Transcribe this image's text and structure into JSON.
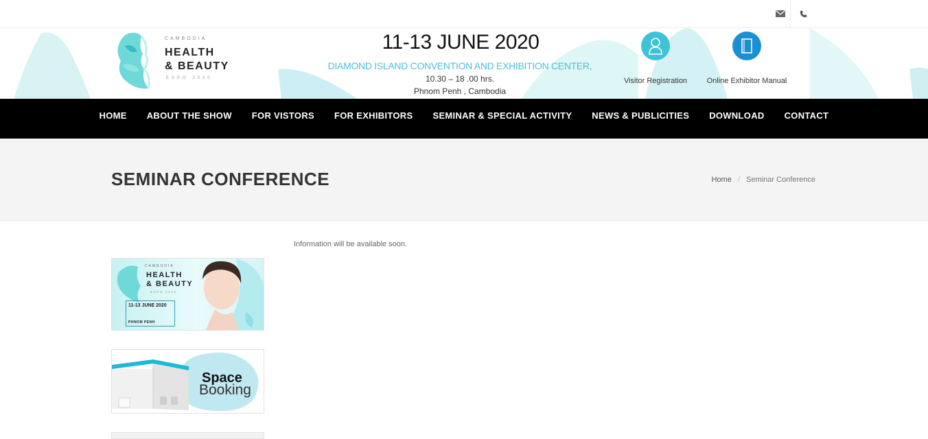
{
  "topbar": {
    "icons": [
      "mail-icon",
      "phone-icon"
    ]
  },
  "header": {
    "logo": {
      "country": "CAMBODIA",
      "line1": "HEALTH",
      "line2": "& BEAUTY",
      "subline": "EXPO 2020"
    },
    "date": "11-13 JUNE 2020",
    "venue": "DIAMOND ISLAND CONVENTION AND EXHIBITION CENTER,",
    "time": "10.30 – 18 .00 hrs.",
    "place": "Phnom Penh , Cambodia",
    "quick_links": [
      {
        "label": "Visitor Registration",
        "icon": "user-icon"
      },
      {
        "label": "Online Exhibitor Manual",
        "icon": "book-icon"
      }
    ]
  },
  "nav": {
    "items": [
      {
        "label": "HOME"
      },
      {
        "label": "ABOUT THE SHOW"
      },
      {
        "label": "FOR VISTORS"
      },
      {
        "label": "FOR EXHIBITORS"
      },
      {
        "label": "SEMINAR & SPECIAL ACTIVITY"
      },
      {
        "label": "NEWS & PUBLICITIES"
      },
      {
        "label": "DOWNLOAD"
      },
      {
        "label": "CONTACT"
      }
    ]
  },
  "page": {
    "title": "SEMINAR CONFERENCE",
    "breadcrumb": {
      "home": "Home",
      "divider": "/",
      "current": "Seminar Conference"
    }
  },
  "content": {
    "info": "Information will be available soon."
  },
  "sidebar": {
    "banner1": {
      "country": "CAMBODIA",
      "line1": "HEALTH",
      "line2": "& BEAUTY",
      "subline": "EXPO 2020",
      "date": "11-13 JUNE 2020",
      "city": "PHNOM PENH"
    },
    "banner2": {
      "line1": "Space",
      "line2": "Booking"
    }
  },
  "colors": {
    "accent": "#3fc2d8",
    "venue": "#4dbfdc",
    "manual": "#1a8fd1",
    "nav_bg": "#000000"
  }
}
